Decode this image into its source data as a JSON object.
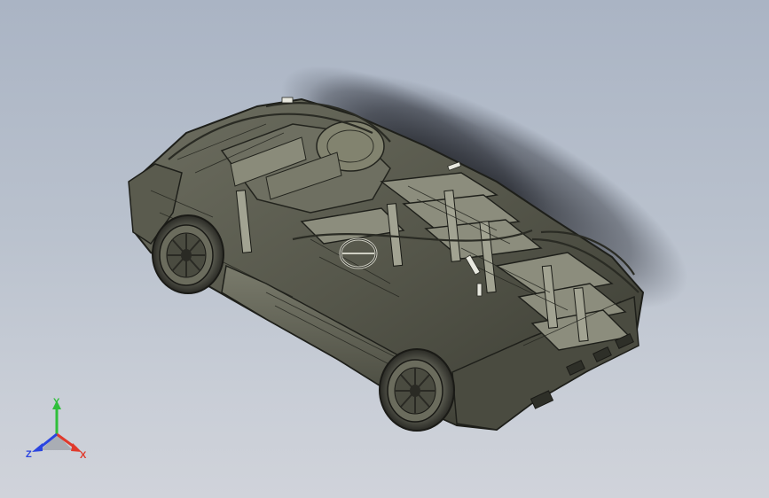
{
  "viewport": {
    "background_top": "#aab4c4",
    "background_bottom": "#d0d3da"
  },
  "model": {
    "body_color": "#55564a",
    "highlight_color": "#9a9b8c"
  },
  "triad": {
    "y_label": "Y",
    "x_label": "X",
    "z_label": "Z",
    "y_color": "#2fbf3a",
    "x_color": "#e03a2c",
    "z_color": "#2a44e0"
  }
}
